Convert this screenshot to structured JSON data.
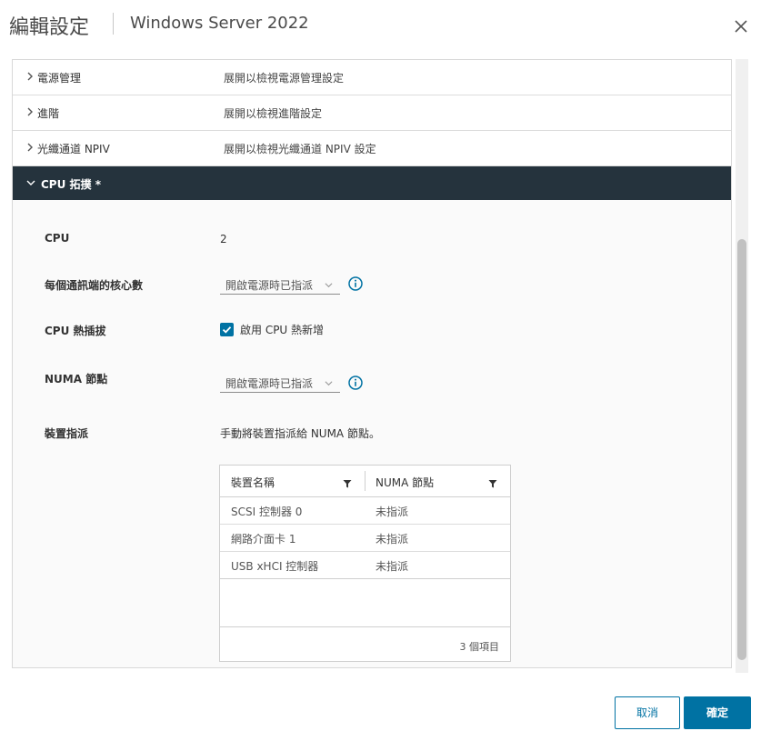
{
  "header": {
    "title": "編輯設定",
    "subtitle": "Windows Server 2022"
  },
  "sections": [
    {
      "name": "電源管理",
      "desc": "展開以檢視電源管理設定"
    },
    {
      "name": "進階",
      "desc": "展開以檢視進階設定"
    },
    {
      "name": "光纖通道 NPIV",
      "desc": "展開以檢視光纖通道 NPIV 設定"
    }
  ],
  "cpu_section": {
    "title": "CPU 拓撲 *",
    "cpu_label": "CPU",
    "cpu_value": "2",
    "cores_label": "每個通訊端的核心數",
    "cores_value": "開啟電源時已指派",
    "hotplug_label": "CPU 熱插拔",
    "hotplug_checkbox_label": "啟用 CPU 熱新增",
    "hotplug_checked": true,
    "numa_label": "NUMA 節點",
    "numa_value": "開啟電源時已指派",
    "device_label": "裝置指派",
    "device_text": "手動將裝置指派給 NUMA 節點。"
  },
  "device_grid": {
    "columns": [
      "裝置名稱",
      "NUMA 節點"
    ],
    "rows": [
      [
        "SCSI 控制器 0",
        "未指派"
      ],
      [
        "網路介面卡 1",
        "未指派"
      ],
      [
        "USB xHCI 控制器",
        "未指派"
      ]
    ],
    "footer": "3 個項目"
  },
  "buttons": {
    "cancel": "取消",
    "ok": "確定"
  },
  "colors": {
    "accent": "#0072a3",
    "section_header_bg": "#25333d"
  }
}
